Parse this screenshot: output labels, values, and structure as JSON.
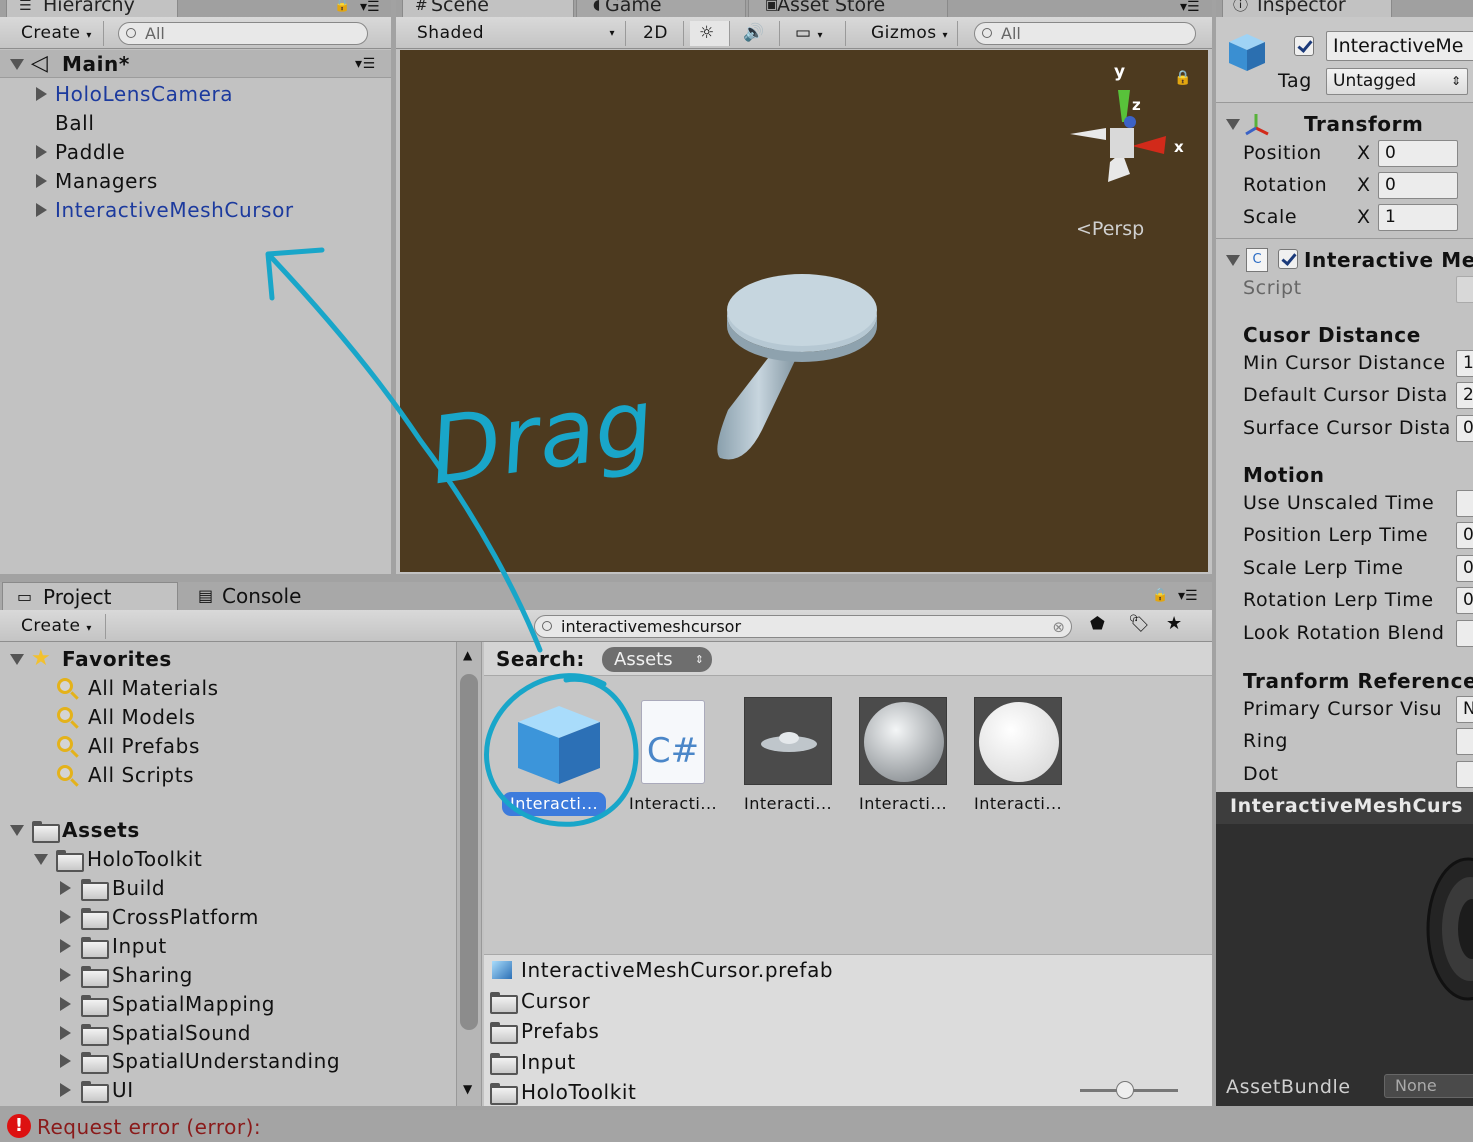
{
  "hierarchy": {
    "tab_label": "Hierarchy",
    "create_label": "Create",
    "search_placeholder": "All",
    "scene_name": "Main*",
    "items": [
      {
        "label": "HoloLensCamera",
        "prefab": true,
        "expandable": true
      },
      {
        "label": "Ball",
        "prefab": false,
        "expandable": false
      },
      {
        "label": "Paddle",
        "prefab": false,
        "expandable": true
      },
      {
        "label": "Managers",
        "prefab": false,
        "expandable": true
      },
      {
        "label": "InteractiveMeshCursor",
        "prefab": true,
        "expandable": true
      }
    ]
  },
  "scene": {
    "tabs": [
      "Scene",
      "Game",
      "Asset Store"
    ],
    "shading": "Shaded",
    "mode_2d": "2D",
    "gizmos_label": "Gizmos",
    "search_placeholder": "All",
    "persp_label": "Persp",
    "axis_x": "x",
    "axis_y": "y",
    "axis_z": "z",
    "background_color": "#4d3a1f"
  },
  "annotation": {
    "text": "Drag",
    "color": "#19a6c9"
  },
  "project": {
    "tabs": [
      "Project",
      "Console"
    ],
    "create_label": "Create",
    "search_value": "interactivemeshcursor",
    "search_label": "Search:",
    "scope": "Assets",
    "favorites_label": "Favorites",
    "favorites": [
      "All Materials",
      "All Models",
      "All Prefabs",
      "All Scripts"
    ],
    "assets_label": "Assets",
    "holotoolkit_label": "HoloToolkit",
    "holotoolkit_children": [
      "Build",
      "CrossPlatform",
      "Input",
      "Sharing",
      "SpatialMapping",
      "SpatialSound",
      "SpatialUnderstanding",
      "UI"
    ],
    "results": [
      {
        "label": "Interacti...",
        "kind": "prefab",
        "selected": true
      },
      {
        "label": "Interacti...",
        "kind": "script",
        "selected": false
      },
      {
        "label": "Interacti...",
        "kind": "mesh",
        "selected": false
      },
      {
        "label": "Interacti...",
        "kind": "material-gray",
        "selected": false
      },
      {
        "label": "Interacti...",
        "kind": "material-white",
        "selected": false
      }
    ],
    "path_items": [
      {
        "label": "InteractiveMeshCursor.prefab",
        "kind": "prefab"
      },
      {
        "label": "Cursor",
        "kind": "folder"
      },
      {
        "label": "Prefabs",
        "kind": "folder"
      },
      {
        "label": "Input",
        "kind": "folder"
      },
      {
        "label": "HoloToolkit",
        "kind": "folder"
      }
    ]
  },
  "inspector": {
    "tab_label": "Inspector",
    "object_name": "InteractiveMe",
    "tag_label": "Tag",
    "tag_value": "Untagged",
    "transform_label": "Transform",
    "transform_rows": [
      {
        "label": "Position",
        "axis": "X",
        "value": "0"
      },
      {
        "label": "Rotation",
        "axis": "X",
        "value": "0"
      },
      {
        "label": "Scale",
        "axis": "X",
        "value": "1"
      }
    ],
    "component_label": "Interactive Me",
    "script_label": "Script",
    "sections": [
      {
        "title": "Cusor Distance",
        "rows": [
          {
            "label": "Min Cursor Distance",
            "value": "1"
          },
          {
            "label": "Default Cursor Dista",
            "value": "2"
          },
          {
            "label": "Surface Cursor Dista",
            "value": "0"
          }
        ]
      },
      {
        "title": "Motion",
        "rows": [
          {
            "label": "Use Unscaled Time",
            "value": ""
          },
          {
            "label": "Position Lerp Time",
            "value": "0"
          },
          {
            "label": "Scale Lerp Time",
            "value": "0"
          },
          {
            "label": "Rotation Lerp Time",
            "value": "0"
          },
          {
            "label": "Look Rotation Blend",
            "value": ""
          }
        ]
      },
      {
        "title": "Tranform Reference",
        "rows": [
          {
            "label": "Primary Cursor Visu",
            "value": "N"
          },
          {
            "label": "Ring",
            "value": ""
          },
          {
            "label": "Dot",
            "value": ""
          }
        ]
      }
    ],
    "preview_title": "InteractiveMeshCurs",
    "assetbundle_label": "AssetBundle",
    "assetbundle_value": "None"
  },
  "status": {
    "error_text": "Request error (error):"
  }
}
